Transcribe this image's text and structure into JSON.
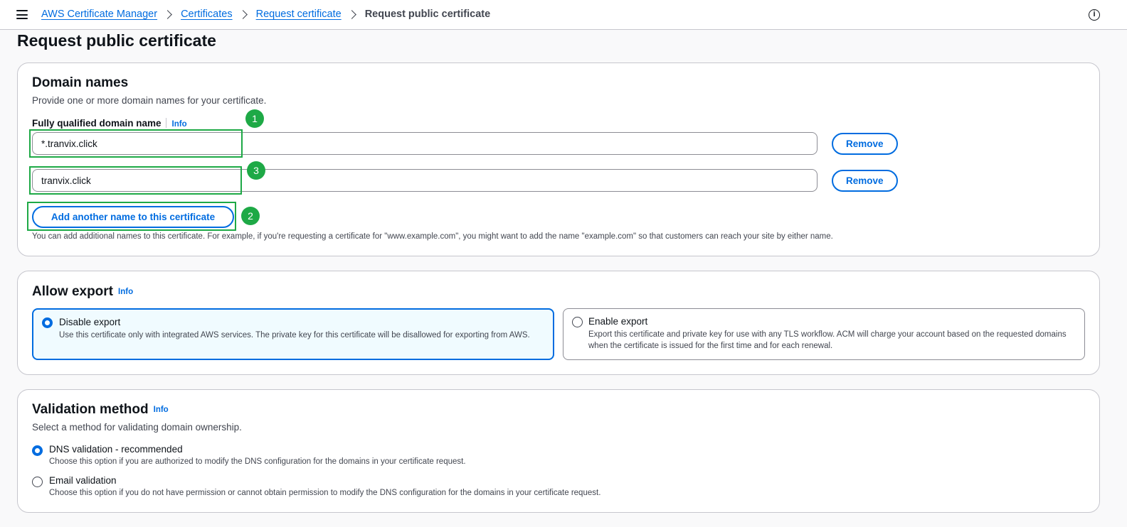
{
  "breadcrumb": {
    "items": [
      "AWS Certificate Manager",
      "Certificates",
      "Request certificate"
    ],
    "current": "Request public certificate"
  },
  "info_icon_glyph": "i",
  "page": {
    "title": "Request public certificate"
  },
  "domain_names": {
    "title": "Domain names",
    "description": "Provide one or more domain names for your certificate.",
    "field_label": "Fully qualified domain name",
    "info_label": "Info",
    "inputs": [
      {
        "value": "*.tranvix.click",
        "remove_label": "Remove"
      },
      {
        "value": "tranvix.click",
        "remove_label": "Remove"
      }
    ],
    "add_button_label": "Add another name to this certificate",
    "hint": "You can add additional names to this certificate. For example, if you're requesting a certificate for \"www.example.com\", you might want to add the name \"example.com\" so that customers can reach your site by either name."
  },
  "allow_export": {
    "title": "Allow export",
    "info_label": "Info",
    "options": [
      {
        "title": "Disable export",
        "description": "Use this certificate only with integrated AWS services. The private key for this certificate will be disallowed for exporting from AWS.",
        "selected": true
      },
      {
        "title": "Enable export",
        "description": "Export this certificate and private key for use with any TLS workflow. ACM will charge your account based on the requested domains when the certificate is issued for the first time and for each renewal.",
        "selected": false
      }
    ]
  },
  "validation_method": {
    "title": "Validation method",
    "info_label": "Info",
    "description": "Select a method for validating domain ownership.",
    "options": [
      {
        "title": "DNS validation - recommended",
        "description": "Choose this option if you are authorized to modify the DNS configuration for the domains in your certificate request.",
        "selected": true
      },
      {
        "title": "Email validation",
        "description": "Choose this option if you do not have permission or cannot obtain permission to modify the DNS configuration for the domains in your certificate request.",
        "selected": false
      }
    ]
  },
  "annotations": {
    "badges": [
      "1",
      "2",
      "3"
    ]
  },
  "colors": {
    "accent": "#006ce0",
    "annotation": "#1ea946",
    "text": "#0f141a",
    "muted": "#424650",
    "border": "#c6c6cd"
  }
}
